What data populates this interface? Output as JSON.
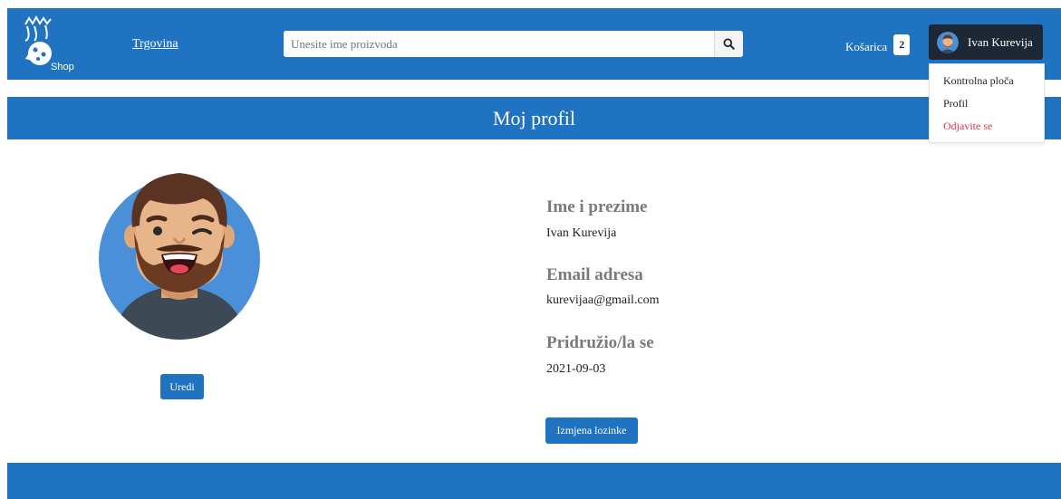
{
  "header": {
    "logo_text": "Shop",
    "nav_link": "Trgovina",
    "search_placeholder": "Unesite ime proizvoda",
    "search_icon": "search-icon",
    "cart_label": "Košarica",
    "cart_count": "2",
    "user_name": "Ivan Kurevija"
  },
  "user_menu": {
    "items": [
      "Kontrolna ploča",
      "Profil",
      "Odjavite se"
    ]
  },
  "page": {
    "title": "Moj profil"
  },
  "profile": {
    "edit_label": "Uredi",
    "fields": [
      {
        "label": "Ime i prezime",
        "value": "Ivan Kurevija"
      },
      {
        "label": "Email adresa",
        "value": "kurevijaa@gmail.com"
      },
      {
        "label": "Pridružio/la se",
        "value": "2021-09-03"
      }
    ],
    "change_password_label": "Izmjena lozinke"
  },
  "colors": {
    "primary": "#2073c0",
    "dark": "#1d2735",
    "danger": "#dc3545",
    "label_gray": "#7a7a7a"
  }
}
